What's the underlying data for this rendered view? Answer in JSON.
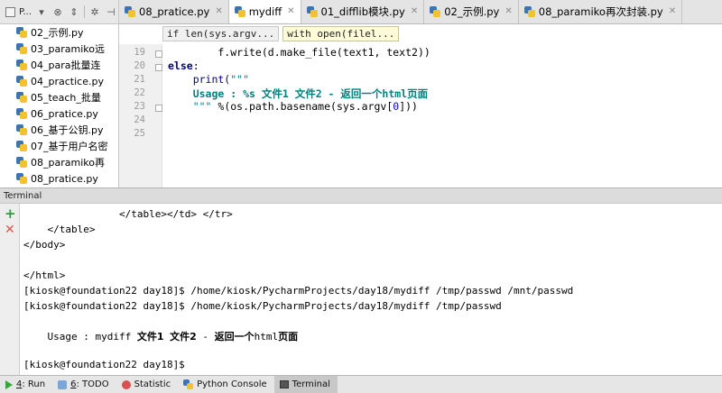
{
  "project": {
    "title": "P...",
    "toolbar_icons": [
      "dropdown-icon",
      "target-icon",
      "collapse-icon",
      "gear-icon",
      "hide-icon"
    ],
    "items": [
      {
        "label": "02_示例.py"
      },
      {
        "label": "03_paramiko远"
      },
      {
        "label": "04_para批量连"
      },
      {
        "label": "04_practice.py"
      },
      {
        "label": "05_teach_批量"
      },
      {
        "label": "06_pratice.py"
      },
      {
        "label": "06_基于公钥.py"
      },
      {
        "label": "07_基于用户名密"
      },
      {
        "label": "08_paramiko再"
      },
      {
        "label": "08_pratice.py"
      }
    ]
  },
  "editor": {
    "tabs": [
      {
        "label": "08_pratice.py",
        "active": false
      },
      {
        "label": "mydiff",
        "active": true
      },
      {
        "label": "01_difflib模块.py",
        "active": false
      },
      {
        "label": "02_示例.py",
        "active": false
      },
      {
        "label": "08_paramiko再次封装.py",
        "active": false
      }
    ],
    "breadcrumbs": [
      {
        "label": "if len(sys.argv..."
      },
      {
        "label": "with open(filel..."
      }
    ],
    "line_numbers": [
      "19",
      "20",
      "21",
      "22",
      "23",
      "24",
      "25"
    ],
    "code": {
      "l19_a": "        f.write(d.make_file(text1, text2))",
      "l20_kw": "else",
      "l20_rest": ":",
      "l21_fn": "    print(",
      "l21_str": "\"\"\"",
      "l22_str": "    Usage : %s 文件1 文件2 - 返回一个html页面",
      "l23_str": "    \"\"\"",
      "l23_a": " %(os.path.basename(sys.argv[",
      "l23_num": "0",
      "l23_b": "]))"
    }
  },
  "terminal": {
    "title": "Terminal",
    "lines": [
      "                </table></td> </tr>",
      "    </table>",
      "</body>",
      "",
      "</html>",
      "[kiosk@foundation22 day18]$ /home/kiosk/PycharmProjects/day18/mydiff /tmp/passwd /mnt/passwd",
      "[kiosk@foundation22 day18]$ /home/kiosk/PycharmProjects/day18/mydiff /tmp/passwd"
    ],
    "usage": {
      "a": "    Usage : mydiff ",
      "b": "文件1",
      "c": " ",
      "d": "文件2",
      "e": " - ",
      "f": "返回一个",
      "g": "html",
      "h": "页面"
    },
    "prompt": "[kiosk@foundation22 day18]$"
  },
  "bottom_bar": {
    "run_num": "4",
    "run_label": ": Run",
    "todo_num": "6",
    "todo_label": ": TODO",
    "statistic": "Statistic",
    "python_console": "Python Console",
    "terminal": "Terminal"
  }
}
